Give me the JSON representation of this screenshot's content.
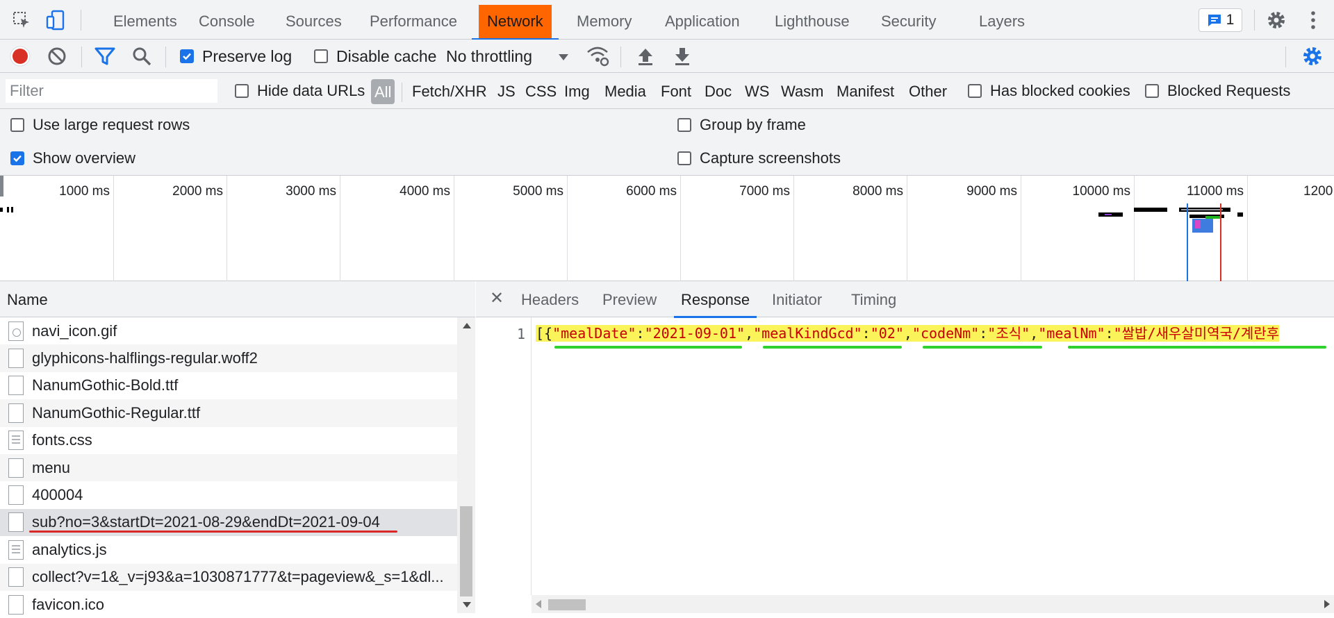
{
  "tabs": [
    "Elements",
    "Console",
    "Sources",
    "Performance",
    "Network",
    "Memory",
    "Application",
    "Lighthouse",
    "Security",
    "Layers"
  ],
  "active_tab": "Network",
  "issues_count": "1",
  "toolbar": {
    "preserve_log_label": "Preserve log",
    "preserve_log_checked": true,
    "disable_cache_label": "Disable cache",
    "disable_cache_checked": false,
    "throttling_value": "No throttling"
  },
  "filter": {
    "placeholder": "Filter",
    "hide_data_urls_label": "Hide data URLs",
    "types": [
      "All",
      "Fetch/XHR",
      "JS",
      "CSS",
      "Img",
      "Media",
      "Font",
      "Doc",
      "WS",
      "Wasm",
      "Manifest",
      "Other"
    ],
    "active_type": "All",
    "has_blocked_cookies_label": "Has blocked cookies",
    "blocked_requests_label": "Blocked Requests"
  },
  "settings": {
    "large_rows_label": "Use large request rows",
    "large_rows_checked": false,
    "show_overview_label": "Show overview",
    "show_overview_checked": true,
    "group_by_frame_label": "Group by frame",
    "group_by_frame_checked": false,
    "capture_screenshots_label": "Capture screenshots",
    "capture_screenshots_checked": false
  },
  "overview": {
    "ticks": [
      "1000 ms",
      "2000 ms",
      "3000 ms",
      "4000 ms",
      "5000 ms",
      "6000 ms",
      "7000 ms",
      "8000 ms",
      "9000 ms",
      "10000 ms",
      "11000 ms",
      "1200"
    ]
  },
  "request_list": {
    "header": "Name",
    "rows": [
      {
        "name": "navi_icon.gif",
        "icon": "image-file-icon"
      },
      {
        "name": "glyphicons-halflings-regular.woff2",
        "icon": "font-file-icon"
      },
      {
        "name": "NanumGothic-Bold.ttf",
        "icon": "font-file-icon"
      },
      {
        "name": "NanumGothic-Regular.ttf",
        "icon": "font-file-icon"
      },
      {
        "name": "fonts.css",
        "icon": "stylesheet-file-icon"
      },
      {
        "name": "menu",
        "icon": "document-file-icon"
      },
      {
        "name": "400004",
        "icon": "document-file-icon"
      },
      {
        "name": "sub?no=3&startDt=2021-08-29&endDt=2021-09-04",
        "icon": "document-file-icon",
        "selected": true
      },
      {
        "name": "analytics.js",
        "icon": "script-file-icon"
      },
      {
        "name": "collect?v=1&_v=j93&a=1030871777&t=pageview&_s=1&dl...",
        "icon": "document-file-icon"
      },
      {
        "name": "favicon.ico",
        "icon": "document-file-icon"
      }
    ]
  },
  "detail": {
    "tabs": [
      "Headers",
      "Preview",
      "Response",
      "Initiator",
      "Timing"
    ],
    "active_tab": "Response",
    "line_number": "1",
    "code": {
      "open": "[{",
      "k1": "\"mealDate\"",
      "v1": "\"2021-09-01\"",
      "k2": "\"mealKindGcd\"",
      "v2": "\"02\"",
      "k3": "\"codeNm\"",
      "v3": "\"조식\"",
      "k4": "\"mealNm\"",
      "v4": "\"쌀밥/새우살미역국/계란후"
    }
  },
  "colors": {
    "network_tab_highlight": "#ff6600",
    "accent": "#1a73e8",
    "record_red": "#d93025",
    "annotation_red": "#d92626",
    "annotation_green": "#2ed12e",
    "response_highlight": "#fbf35a"
  }
}
